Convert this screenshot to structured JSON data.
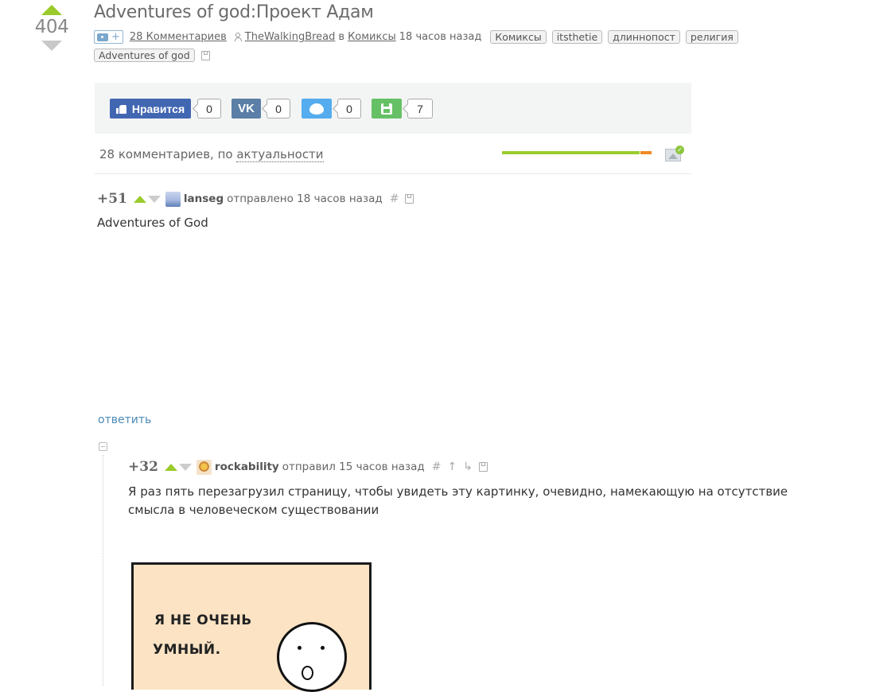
{
  "story": {
    "rating": "404",
    "title": "Adventures of god:Проект Адам",
    "comments_link": "28 Комментариев",
    "author": "TheWalkingBread",
    "in_word": "в",
    "community": "Комиксы",
    "time": "18 часов назад",
    "tags": [
      "Комиксы",
      "itsthetie",
      "длиннопост",
      "религия",
      "Adventures of god"
    ],
    "icons": {
      "add_photo": "camera-plus-icon",
      "author": "user-icon",
      "save": "floppy-disk-icon"
    }
  },
  "share": {
    "facebook": {
      "label": "Нравится",
      "count": "0",
      "color": "#4267b2"
    },
    "vk": {
      "label": "VK",
      "count": "0",
      "color": "#5b7fa6"
    },
    "twitter": {
      "count": "0",
      "color": "#55acee"
    },
    "save": {
      "count": "7",
      "color": "#66c166"
    }
  },
  "comments_header": {
    "count_text": "28 комментариев, по",
    "sort_label": "актуальности",
    "rating_bar": {
      "positive_fraction": 0.92,
      "positive_color": "#9ccc2e",
      "negative_color": "#f08a24"
    }
  },
  "comments": [
    {
      "score": "+51",
      "username": "lanseg",
      "action": "отправлено 18 часов назад",
      "tools": [
        "#"
      ],
      "body": "Adventures of God",
      "reply_label": "ответить"
    },
    {
      "score": "+32",
      "username": "rockability",
      "action": "отправил 15 часов назад",
      "tools": [
        "#",
        "↑",
        "↳"
      ],
      "body": "Я раз пять перезагрузил страницу, чтобы увидеть эту картинку, очевидно, намекающую на отсутствие смысла в человеческом существовании",
      "comic": {
        "line1": "Я НЕ ОЧЕНЬ",
        "line2": "УМНЫЙ."
      }
    }
  ]
}
